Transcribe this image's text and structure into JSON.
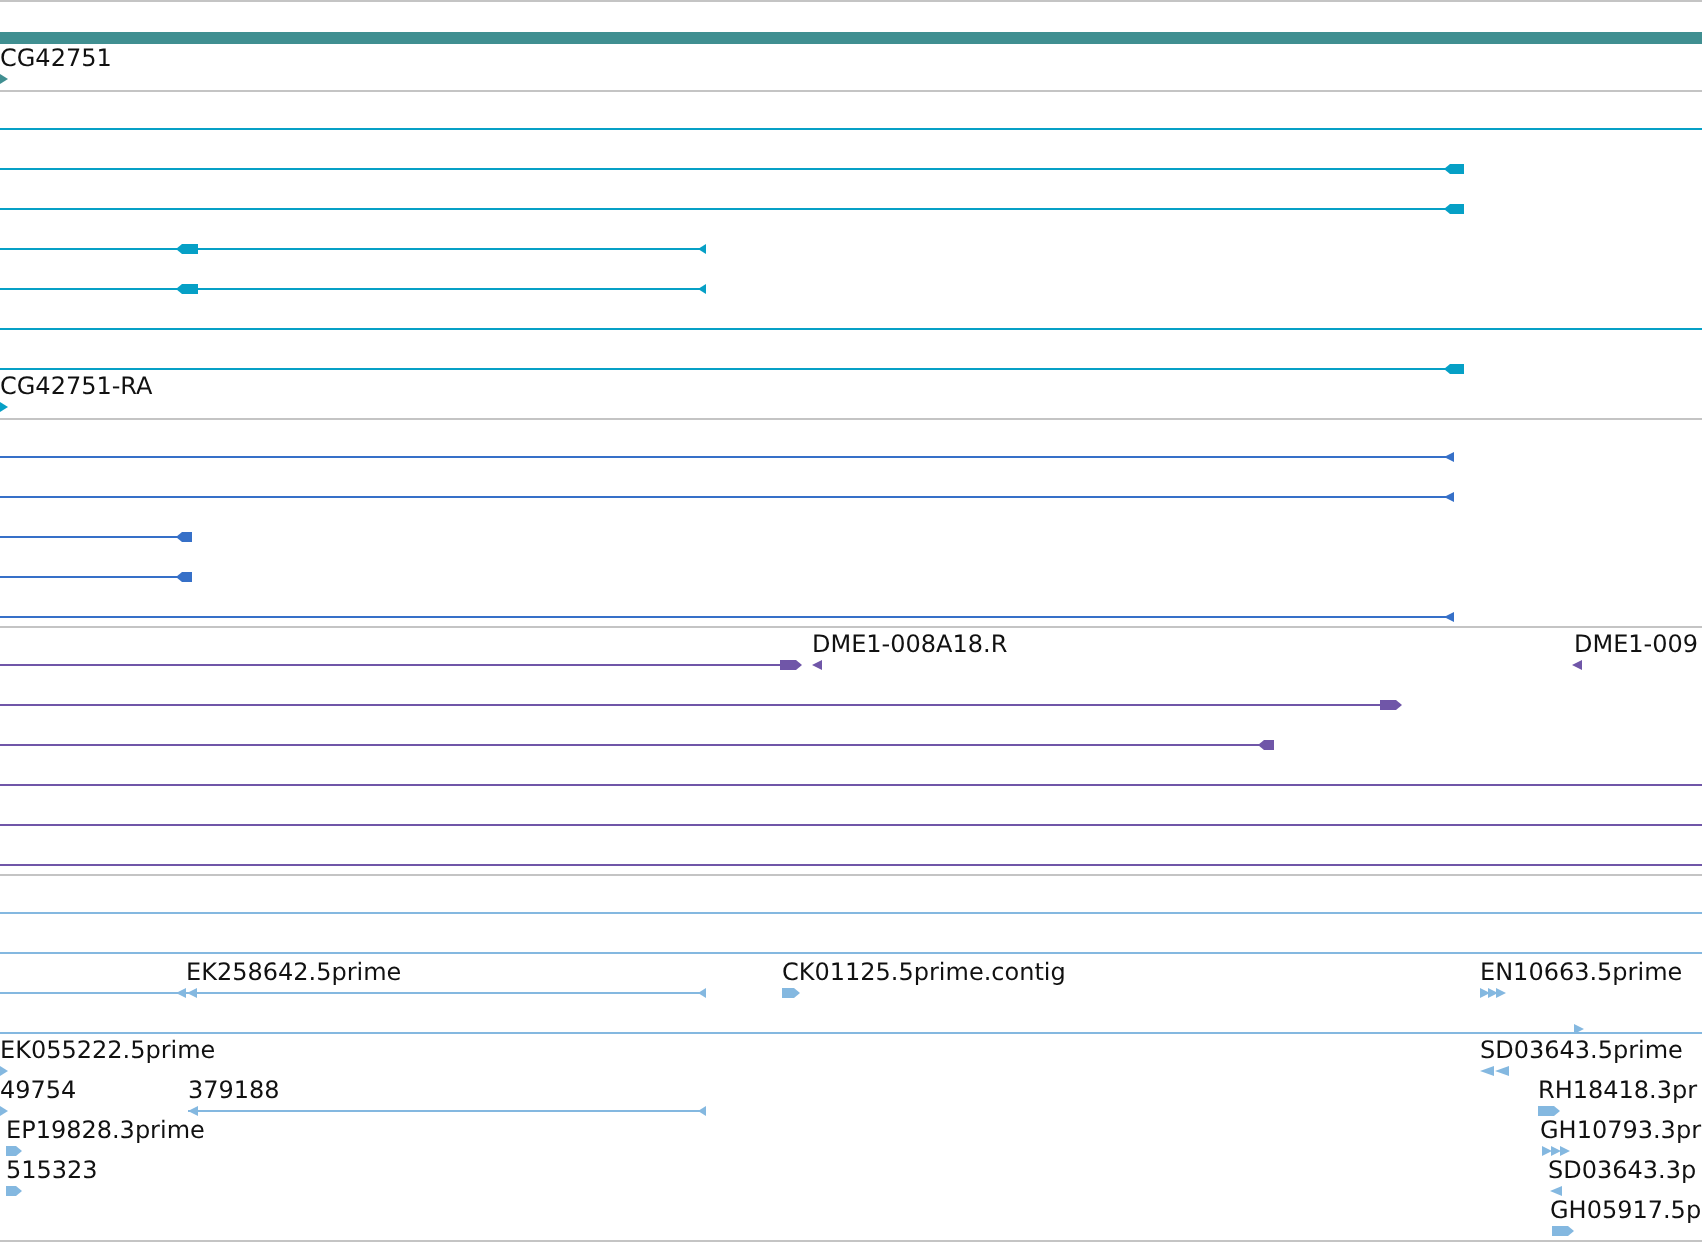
{
  "tracks": [
    {
      "color": "#408f91",
      "features": [
        {
          "kind": "bar"
        },
        {
          "kind": "forward",
          "label": "CG42751"
        }
      ]
    },
    {
      "color": "#06a0c6",
      "features": [
        {
          "kind": "line"
        },
        {
          "kind": "reverse"
        },
        {
          "kind": "reverse"
        },
        {
          "kind": "reverse"
        },
        {
          "kind": "reverse"
        },
        {
          "kind": "line"
        },
        {
          "kind": "reverse"
        },
        {
          "kind": "forward",
          "label": "CG42751-RA"
        }
      ]
    },
    {
      "color": "#3670c8",
      "features": [
        {
          "kind": "reverse"
        },
        {
          "kind": "reverse"
        },
        {
          "kind": "reverse"
        },
        {
          "kind": "reverse"
        },
        {
          "kind": "reverse"
        }
      ]
    },
    {
      "color": "#7056a8",
      "features": [
        {
          "kind": "forward"
        },
        {
          "kind": "reverse",
          "label": "DME1-008A18.R"
        },
        {
          "kind": "reverse",
          "label": "DME1-009"
        },
        {
          "kind": "forward"
        },
        {
          "kind": "reverse"
        },
        {
          "kind": "line"
        },
        {
          "kind": "line"
        },
        {
          "kind": "line"
        }
      ]
    },
    {
      "color": "#84b8e0",
      "features": [
        {
          "kind": "line"
        },
        {
          "kind": "line"
        },
        {
          "kind": "reverse",
          "label": "EK258642.5prime"
        },
        {
          "kind": "forward",
          "label": "CK01125.5prime.contig"
        },
        {
          "kind": "forward",
          "label": "EN10663.5prime"
        },
        {
          "kind": "line"
        },
        {
          "kind": "forward"
        },
        {
          "kind": "forward",
          "label": "EK055222.5prime"
        },
        {
          "kind": "reverse",
          "label": "SD03643.5prime"
        },
        {
          "kind": "forward",
          "label": "49754"
        },
        {
          "kind": "reverse",
          "label": "379188"
        },
        {
          "kind": "forward",
          "label": "RH18418.3pr"
        },
        {
          "kind": "forward",
          "label": "EP19828.3prime"
        },
        {
          "kind": "forward",
          "label": "GH10793.3pr"
        },
        {
          "kind": "forward",
          "label": "515323"
        },
        {
          "kind": "reverse",
          "label": "SD03643.3p"
        },
        {
          "kind": "forward",
          "label": "GH05917.5p"
        }
      ]
    }
  ]
}
